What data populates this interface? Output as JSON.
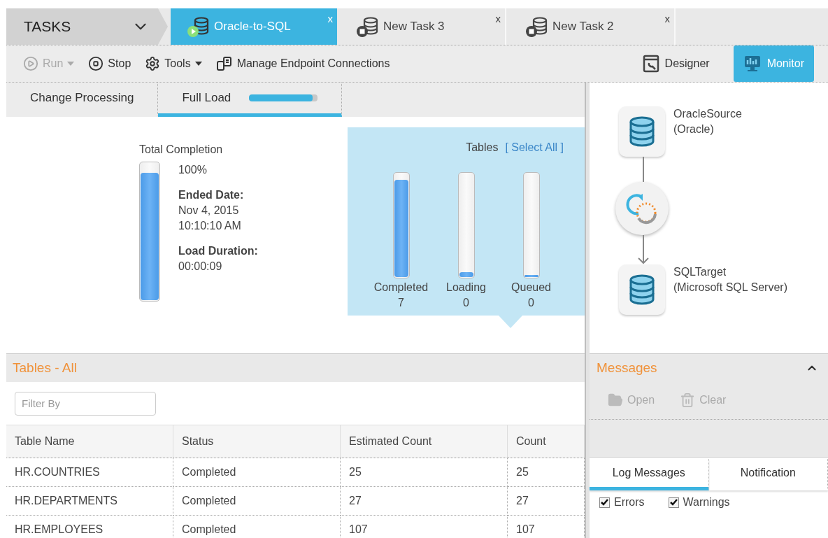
{
  "task_bar": {
    "title": "TASKS",
    "tabs": [
      {
        "label": "Oracle-to-SQL",
        "selected": true,
        "kind": "running",
        "close": "x"
      },
      {
        "label": "New Task 3",
        "selected": false,
        "kind": "stopped",
        "close": "x"
      },
      {
        "label": "New Task 2",
        "selected": false,
        "kind": "stopped",
        "close": "x"
      }
    ]
  },
  "toolbar": {
    "buttons": [
      {
        "label": "Run",
        "kind": "run",
        "disabled": true,
        "menu": true
      },
      {
        "label": "Stop",
        "kind": "stop",
        "disabled": false,
        "menu": false
      },
      {
        "label": "Tools",
        "kind": "tools",
        "disabled": false,
        "menu": true
      },
      {
        "label": "Manage Endpoint Connections",
        "kind": "endpoints",
        "disabled": false,
        "menu": false
      }
    ],
    "views": [
      {
        "label": "Designer",
        "kind": "designer",
        "selected": false
      },
      {
        "label": "Monitor",
        "kind": "monitor",
        "selected": true
      }
    ]
  },
  "view_tabs": [
    {
      "label": "Change Processing",
      "selected": false
    },
    {
      "label": "Full Load",
      "selected": true,
      "level": 0.93
    }
  ],
  "total_completion": {
    "title": "Total Completion",
    "level": 0.93,
    "percent": "100%",
    "fields": [
      {
        "label": "Ended Date:",
        "lines": [
          "Nov 4, 2015",
          "10:10:10 AM"
        ]
      },
      {
        "label": "Load Duration:",
        "lines": [
          "00:00:09"
        ]
      }
    ]
  },
  "tables_summary": {
    "title": "Tables",
    "link": "[ Select All ]",
    "bars": [
      {
        "label": "Completed",
        "count": "7",
        "level": 0.94
      },
      {
        "label": "Loading",
        "count": "0",
        "level": 0.05
      },
      {
        "label": "Queued",
        "count": "0",
        "level": 0.02
      }
    ]
  },
  "tables_list": {
    "title": "Tables - All",
    "filter": {
      "placeholder": "Filter By"
    },
    "columns": [
      "Table Name",
      "Status",
      "Estimated Count",
      "Count"
    ],
    "rows": [
      [
        "HR.COUNTRIES",
        "Completed",
        "25",
        "25"
      ],
      [
        "HR.DEPARTMENTS",
        "Completed",
        "27",
        "27"
      ],
      [
        "HR.EMPLOYEES",
        "Completed",
        "107",
        "107"
      ]
    ]
  },
  "diagram": {
    "nodes": [
      {
        "kind": "database",
        "name": "OracleSource",
        "detail": "(Oracle)"
      },
      {
        "kind": "process"
      },
      {
        "kind": "database",
        "name": "SQLTarget",
        "detail": "(Microsoft SQL Server)"
      }
    ]
  },
  "messages": {
    "title": "Messages",
    "expanded": true,
    "actions": [
      {
        "label": "Open",
        "kind": "open",
        "disabled": true
      },
      {
        "label": "Clear",
        "kind": "clear",
        "disabled": true
      }
    ],
    "tabs": [
      {
        "label": "Log Messages",
        "selected": true
      },
      {
        "label": "Notification",
        "selected": false
      }
    ],
    "filters": [
      {
        "label": "Errors",
        "checked": true
      },
      {
        "label": "Warnings",
        "checked": true
      }
    ]
  }
}
